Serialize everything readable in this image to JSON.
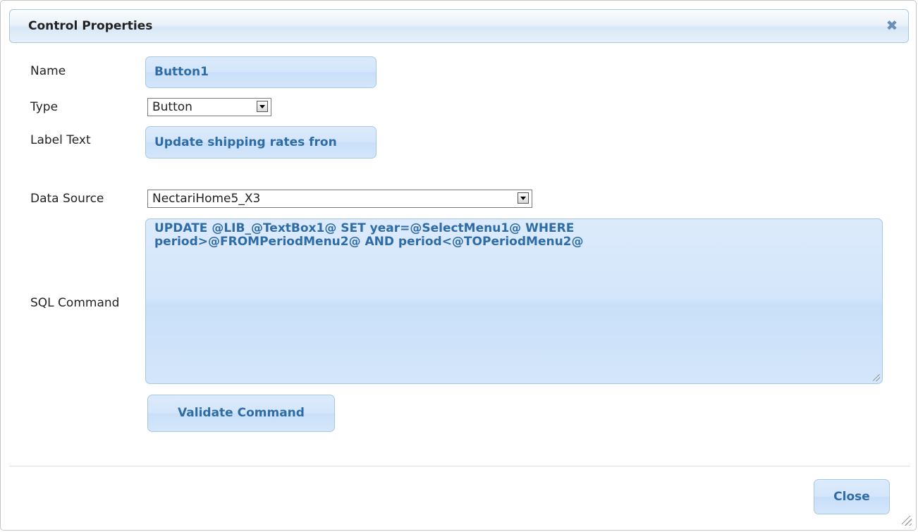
{
  "dialog": {
    "title": "Control Properties",
    "close_icon": "close-icon"
  },
  "form": {
    "name": {
      "label": "Name",
      "value": "Button1"
    },
    "type": {
      "label": "Type",
      "value": "Button"
    },
    "label_text": {
      "label": "Label Text",
      "value": "Update shipping rates fron"
    },
    "data_source": {
      "label": "Data Source",
      "value": "NectariHome5_X3"
    },
    "sql_command": {
      "label": "SQL Command",
      "line1": "UPDATE @LIB_@TextBox1@ SET year=@SelectMenu1@ WHERE",
      "line2": "period>@FROMPeriodMenu2@ AND period<@TOPeriodMenu2@"
    },
    "validate_button": "Validate Command"
  },
  "footer": {
    "close_button": "Close"
  },
  "colors": {
    "accent_text": "#2e6ca7",
    "field_bg": "#d4e6fb",
    "field_border": "#a6c9e2"
  }
}
